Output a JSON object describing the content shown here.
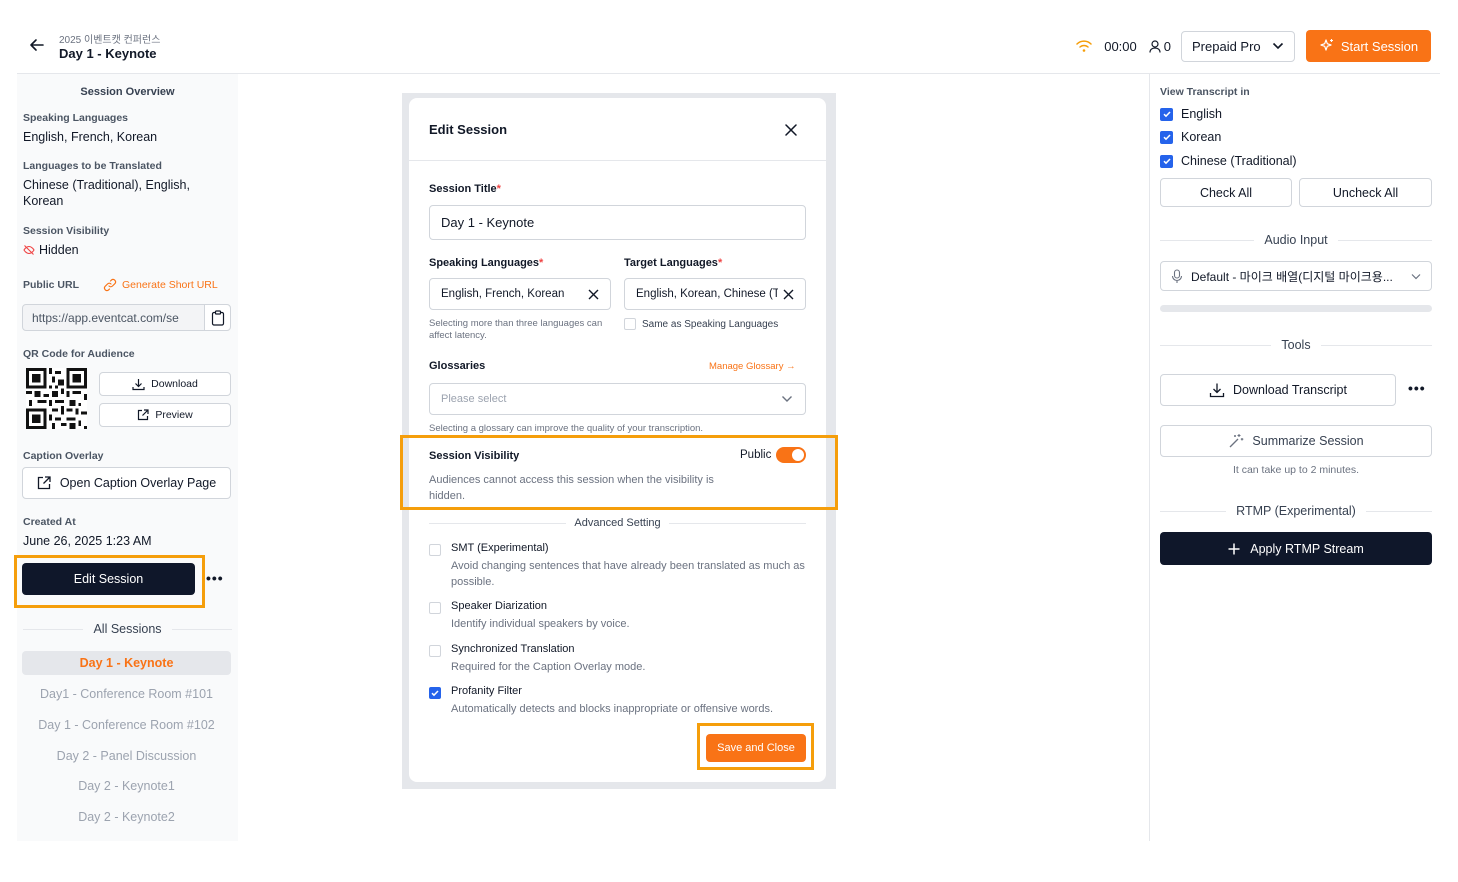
{
  "header": {
    "subtitle": "2025 이벤트캣 컨퍼런스",
    "title": "Day 1 - Keynote",
    "timer": "00:00",
    "user_count": "0",
    "plan": "Prepaid Pro",
    "start_label": "Start Session"
  },
  "sidebar": {
    "overview_title": "Session Overview",
    "speaking_label": "Speaking Languages",
    "speaking_value": "English, French, Korean",
    "translated_label": "Languages to be Translated",
    "translated_value": "Chinese (Traditional), English, Korean",
    "visibility_label": "Session Visibility",
    "visibility_value": "Hidden",
    "url_label": "Public URL",
    "generate_label": "Generate Short URL",
    "url_value": "https://app.eventcat.com/se",
    "qr_label": "QR Code for Audience",
    "download_label": "Download",
    "preview_label": "Preview",
    "overlay_label": "Caption Overlay",
    "overlay_button": "Open Caption Overlay Page",
    "created_label": "Created At",
    "created_value": "June 26, 2025 1:23 AM",
    "edit_button": "Edit Session",
    "all_sessions_title": "All Sessions",
    "sessions": [
      {
        "label": "Day 1 - Keynote",
        "active": true
      },
      {
        "label": "Day1 - Conference Room #101",
        "active": false
      },
      {
        "label": "Day 1 - Conference Room #102",
        "active": false
      },
      {
        "label": "Day 2 - Panel Discussion",
        "active": false
      },
      {
        "label": "Day 2 - Keynote1",
        "active": false
      },
      {
        "label": "Day 2 - Keynote2",
        "active": false
      }
    ]
  },
  "modal": {
    "title": "Edit Session",
    "session_title_label": "Session Title",
    "session_title_value": "Day 1 - Keynote",
    "speaking_label": "Speaking Languages",
    "speaking_value": "English, French, Korean",
    "speaking_hint": "Selecting more than three languages can affect latency.",
    "target_label": "Target Languages",
    "target_value": "English, Korean, Chinese (Traditional)",
    "same_as_label": "Same as Speaking Languages",
    "glossaries_label": "Glossaries",
    "manage_glossary": "Manage Glossary →",
    "glossary_placeholder": "Please select",
    "glossary_hint": "Selecting a glossary can improve the quality of your transcription.",
    "visibility_title": "Session Visibility",
    "visibility_state": "Public",
    "visibility_on": true,
    "visibility_desc": "Audiences cannot access this session when the visibility is hidden.",
    "advanced_title": "Advanced Setting",
    "options": [
      {
        "title": "SMT (Experimental)",
        "desc": "Avoid changing sentences that have already been translated as much as possible.",
        "checked": false
      },
      {
        "title": "Speaker Diarization",
        "desc": "Identify individual speakers by voice.",
        "checked": false
      },
      {
        "title": "Synchronized Translation",
        "desc": "Required for the Caption Overlay mode.",
        "checked": false
      },
      {
        "title": "Profanity Filter",
        "desc": "Automatically detects and blocks inappropriate or offensive words.",
        "checked": true
      }
    ],
    "save_button": "Save and Close"
  },
  "right_panel": {
    "view_label": "View Transcript in",
    "languages": [
      {
        "label": "English",
        "checked": true
      },
      {
        "label": "Korean",
        "checked": true
      },
      {
        "label": "Chinese (Traditional)",
        "checked": true
      }
    ],
    "check_all": "Check All",
    "uncheck_all": "Uncheck All",
    "audio_title": "Audio Input",
    "audio_device": "Default - 마이크 배열(디지털 마이크용...",
    "tools_title": "Tools",
    "download_transcript": "Download Transcript",
    "summarize": "Summarize Session",
    "summarize_hint": "It can take up to 2 minutes.",
    "rtmp_title": "RTMP (Experimental)",
    "rtmp_button": "Apply RTMP Stream"
  },
  "colors": {
    "accent": "#f97316",
    "dark_button": "#0f172a",
    "highlight": "#f59e0b",
    "checkbox": "#2563eb"
  }
}
